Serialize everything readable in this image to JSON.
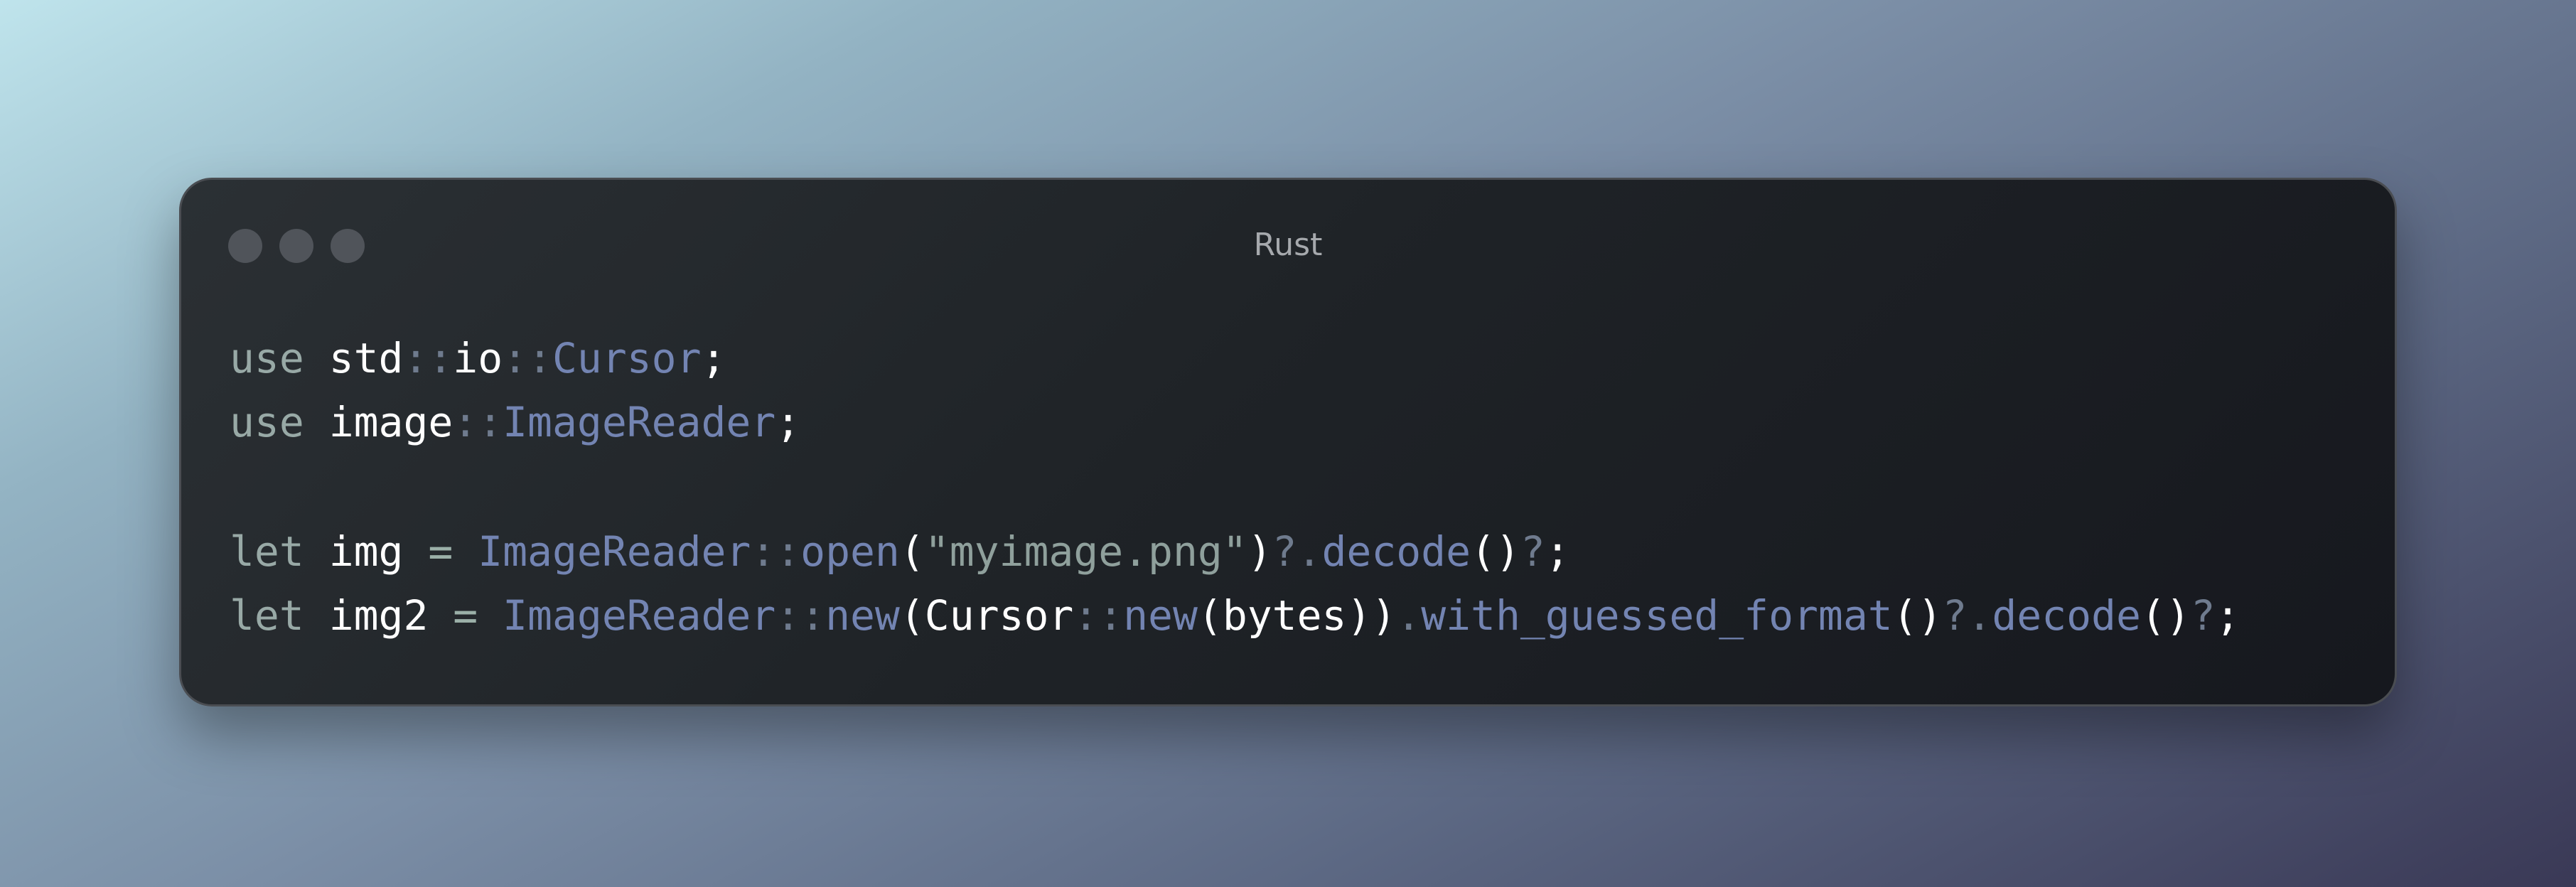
{
  "window": {
    "title": "Rust",
    "controls": [
      "close",
      "minimize",
      "zoom"
    ]
  },
  "code": {
    "language": "Rust",
    "lines": [
      [
        {
          "t": "use",
          "k": "kw"
        },
        {
          "t": " ",
          "k": "plain"
        },
        {
          "t": "std",
          "k": "id"
        },
        {
          "t": "::",
          "k": "punc"
        },
        {
          "t": "io",
          "k": "id"
        },
        {
          "t": "::",
          "k": "punc"
        },
        {
          "t": "Cursor",
          "k": "type"
        },
        {
          "t": ";",
          "k": "plain"
        }
      ],
      [
        {
          "t": "use",
          "k": "kw"
        },
        {
          "t": " ",
          "k": "plain"
        },
        {
          "t": "image",
          "k": "id"
        },
        {
          "t": "::",
          "k": "punc"
        },
        {
          "t": "ImageReader",
          "k": "type"
        },
        {
          "t": ";",
          "k": "plain"
        }
      ],
      [],
      [
        {
          "t": "let",
          "k": "kw"
        },
        {
          "t": " ",
          "k": "plain"
        },
        {
          "t": "img",
          "k": "id"
        },
        {
          "t": " ",
          "k": "plain"
        },
        {
          "t": "=",
          "k": "op"
        },
        {
          "t": " ",
          "k": "plain"
        },
        {
          "t": "ImageReader",
          "k": "type"
        },
        {
          "t": "::",
          "k": "punc"
        },
        {
          "t": "open",
          "k": "fn"
        },
        {
          "t": "(",
          "k": "plain"
        },
        {
          "t": "\"myimage.png\"",
          "k": "str"
        },
        {
          "t": ")",
          "k": "plain"
        },
        {
          "t": "?.",
          "k": "punc"
        },
        {
          "t": "decode",
          "k": "fn"
        },
        {
          "t": "()",
          "k": "plain"
        },
        {
          "t": "?",
          "k": "punc"
        },
        {
          "t": ";",
          "k": "plain"
        }
      ],
      [
        {
          "t": "let",
          "k": "kw"
        },
        {
          "t": " ",
          "k": "plain"
        },
        {
          "t": "img2",
          "k": "id"
        },
        {
          "t": " ",
          "k": "plain"
        },
        {
          "t": "=",
          "k": "op"
        },
        {
          "t": " ",
          "k": "plain"
        },
        {
          "t": "ImageReader",
          "k": "type"
        },
        {
          "t": "::",
          "k": "punc"
        },
        {
          "t": "new",
          "k": "fn"
        },
        {
          "t": "(",
          "k": "plain"
        },
        {
          "t": "Cursor",
          "k": "plain"
        },
        {
          "t": "::",
          "k": "punc"
        },
        {
          "t": "new",
          "k": "fn"
        },
        {
          "t": "(",
          "k": "plain"
        },
        {
          "t": "bytes",
          "k": "plain"
        },
        {
          "t": "))",
          "k": "plain"
        },
        {
          "t": ".",
          "k": "punc"
        },
        {
          "t": "with_guessed_format",
          "k": "fn"
        },
        {
          "t": "()",
          "k": "plain"
        },
        {
          "t": "?.",
          "k": "punc"
        },
        {
          "t": "decode",
          "k": "fn"
        },
        {
          "t": "()",
          "k": "plain"
        },
        {
          "t": "?",
          "k": "punc"
        },
        {
          "t": ";",
          "k": "plain"
        }
      ]
    ]
  },
  "colors": {
    "keyword": "#98a9a6",
    "identifier": "#ffffff",
    "path_separator": "#6f7b8e",
    "type": "#7384b2",
    "function": "#7384b2",
    "string": "#8fa09c",
    "window_bg": "#1f2327",
    "window_border": "#4a4d52",
    "traffic_light": "#50545a"
  }
}
